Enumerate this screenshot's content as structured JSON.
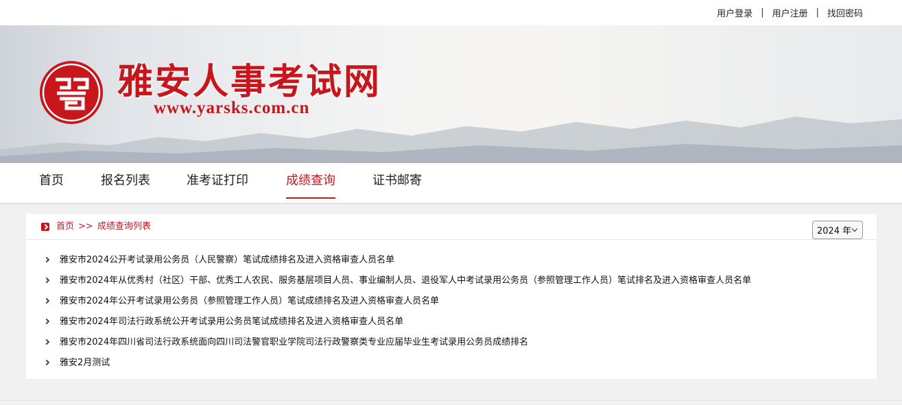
{
  "header": {
    "links": [
      "用户登录",
      "用户注册",
      "找回密码"
    ],
    "separator": "|",
    "site_title": "雅安人事考试网",
    "site_url": "www.yarsks.com.cn",
    "logo_icon": "seal-logo-icon"
  },
  "nav": {
    "items": [
      "首页",
      "报名列表",
      "准考证打印",
      "成绩查询",
      "证书邮寄"
    ],
    "active": "成绩查询"
  },
  "breadcrumb": {
    "home": "首页",
    "arrow": ">>",
    "current": "成绩查询列表"
  },
  "year_select": {
    "value": "2024 年"
  },
  "results": [
    "雅安市2024公开考试录用公务员（人民警察）笔试成绩排名及进入资格审查人员名单",
    "雅安市2024年从优秀村（社区）干部、优秀工人农民、服务基层项目人员、事业编制人员、退役军人中考试录用公务员（参照管理工作人员）笔试排名及进入资格审查人员名单",
    "雅安市2024年公开考试录用公务员（参照管理工作人员）笔试成绩排名及进入资格审查人员名单",
    "雅安市2024年司法行政系统公开考试录用公务员笔试成绩排名及进入资格审查人员名单",
    "雅安市2024年四川省司法行政系统面向四川司法警官职业学院司法行政警察类专业应届毕业生考试录用公务员成绩排名",
    "雅安2月测试"
  ],
  "colors": {
    "brand_red": "#c8161d",
    "bullet_blue": "#1a4f86"
  }
}
